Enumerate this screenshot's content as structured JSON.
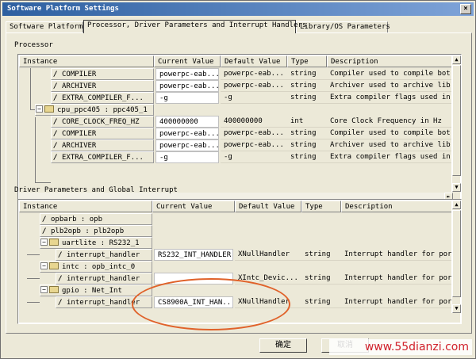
{
  "window": {
    "title": "Software Platform Settings",
    "close_label": "×"
  },
  "tabs": [
    {
      "label": "Software Platform"
    },
    {
      "label": "Processor, Driver Parameters and Interrupt Handlers"
    },
    {
      "label": "Library/OS Parameters"
    }
  ],
  "processor_group": {
    "label": "Processor",
    "columns": [
      "Instance",
      "Current Value",
      "Default Value",
      "Type",
      "Description"
    ],
    "rows": [
      {
        "instance": "COMPILER",
        "current": "powerpc-eab...",
        "default": "powerpc-eab...",
        "type": "string",
        "desc": "Compiler used to compile bot..."
      },
      {
        "instance": "ARCHIVER",
        "current": "powerpc-eab...",
        "default": "powerpc-eab...",
        "type": "string",
        "desc": "Archiver used to archive lib..."
      },
      {
        "instance": "EXTRA_COMPILER_F...",
        "current": "-g",
        "default": "-g",
        "type": "string",
        "desc": "Extra compiler flags used in..."
      },
      {
        "instance": "cpu_ppc405 : ppc405_1",
        "current": "",
        "default": "",
        "type": "",
        "desc": ""
      },
      {
        "instance": "CORE_CLOCK_FREQ_HZ",
        "current": "400000000",
        "default": "400000000",
        "type": "int",
        "desc": "Core Clock Frequency in Hz"
      },
      {
        "instance": "COMPILER",
        "current": "powerpc-eab...",
        "default": "powerpc-eab...",
        "type": "string",
        "desc": "Compiler used to compile bot..."
      },
      {
        "instance": "ARCHIVER",
        "current": "powerpc-eab...",
        "default": "powerpc-eab...",
        "type": "string",
        "desc": "Archiver used to archive lib..."
      },
      {
        "instance": "EXTRA_COMPILER_F...",
        "current": "-g",
        "default": "-g",
        "type": "string",
        "desc": "Extra compiler flags used in..."
      }
    ]
  },
  "driver_group": {
    "label": "Driver Parameters and Global Interrupt",
    "columns": [
      "Instance",
      "Current Value",
      "Default Value",
      "Type",
      "Description"
    ],
    "rows": [
      {
        "instance": "opbarb : opb",
        "current": "",
        "default": "",
        "type": "",
        "desc": ""
      },
      {
        "instance": "plb2opb : plb2opb",
        "current": "",
        "default": "",
        "type": "",
        "desc": ""
      },
      {
        "instance": "uartlite : RS232_1",
        "current": "",
        "default": "",
        "type": "",
        "desc": ""
      },
      {
        "instance": "interrupt_handler",
        "current": "RS232_INT_HANDLER",
        "default": "XNullHandler",
        "type": "string",
        "desc": "Interrupt handler for port:"
      },
      {
        "instance": "intc : opb_intc_0",
        "current": "",
        "default": "",
        "type": "",
        "desc": ""
      },
      {
        "instance": "interrupt_handler",
        "current": "",
        "default": "XIntc_Devic...",
        "type": "string",
        "desc": "Interrupt handler for port:"
      },
      {
        "instance": "gpio : Net_Int",
        "current": "",
        "default": "",
        "type": "",
        "desc": ""
      },
      {
        "instance": "interrupt_handler",
        "current": "CS8900A_INT_HAN...",
        "default": "XNullHandler",
        "type": "string",
        "desc": "Interrupt handler for port:"
      }
    ]
  },
  "buttons": {
    "ok": "确定",
    "cancel": "取消"
  },
  "watermark": "www.55dianzi.com",
  "colors": {
    "annotation": "#e0622a",
    "watermark": "#d0202a"
  }
}
